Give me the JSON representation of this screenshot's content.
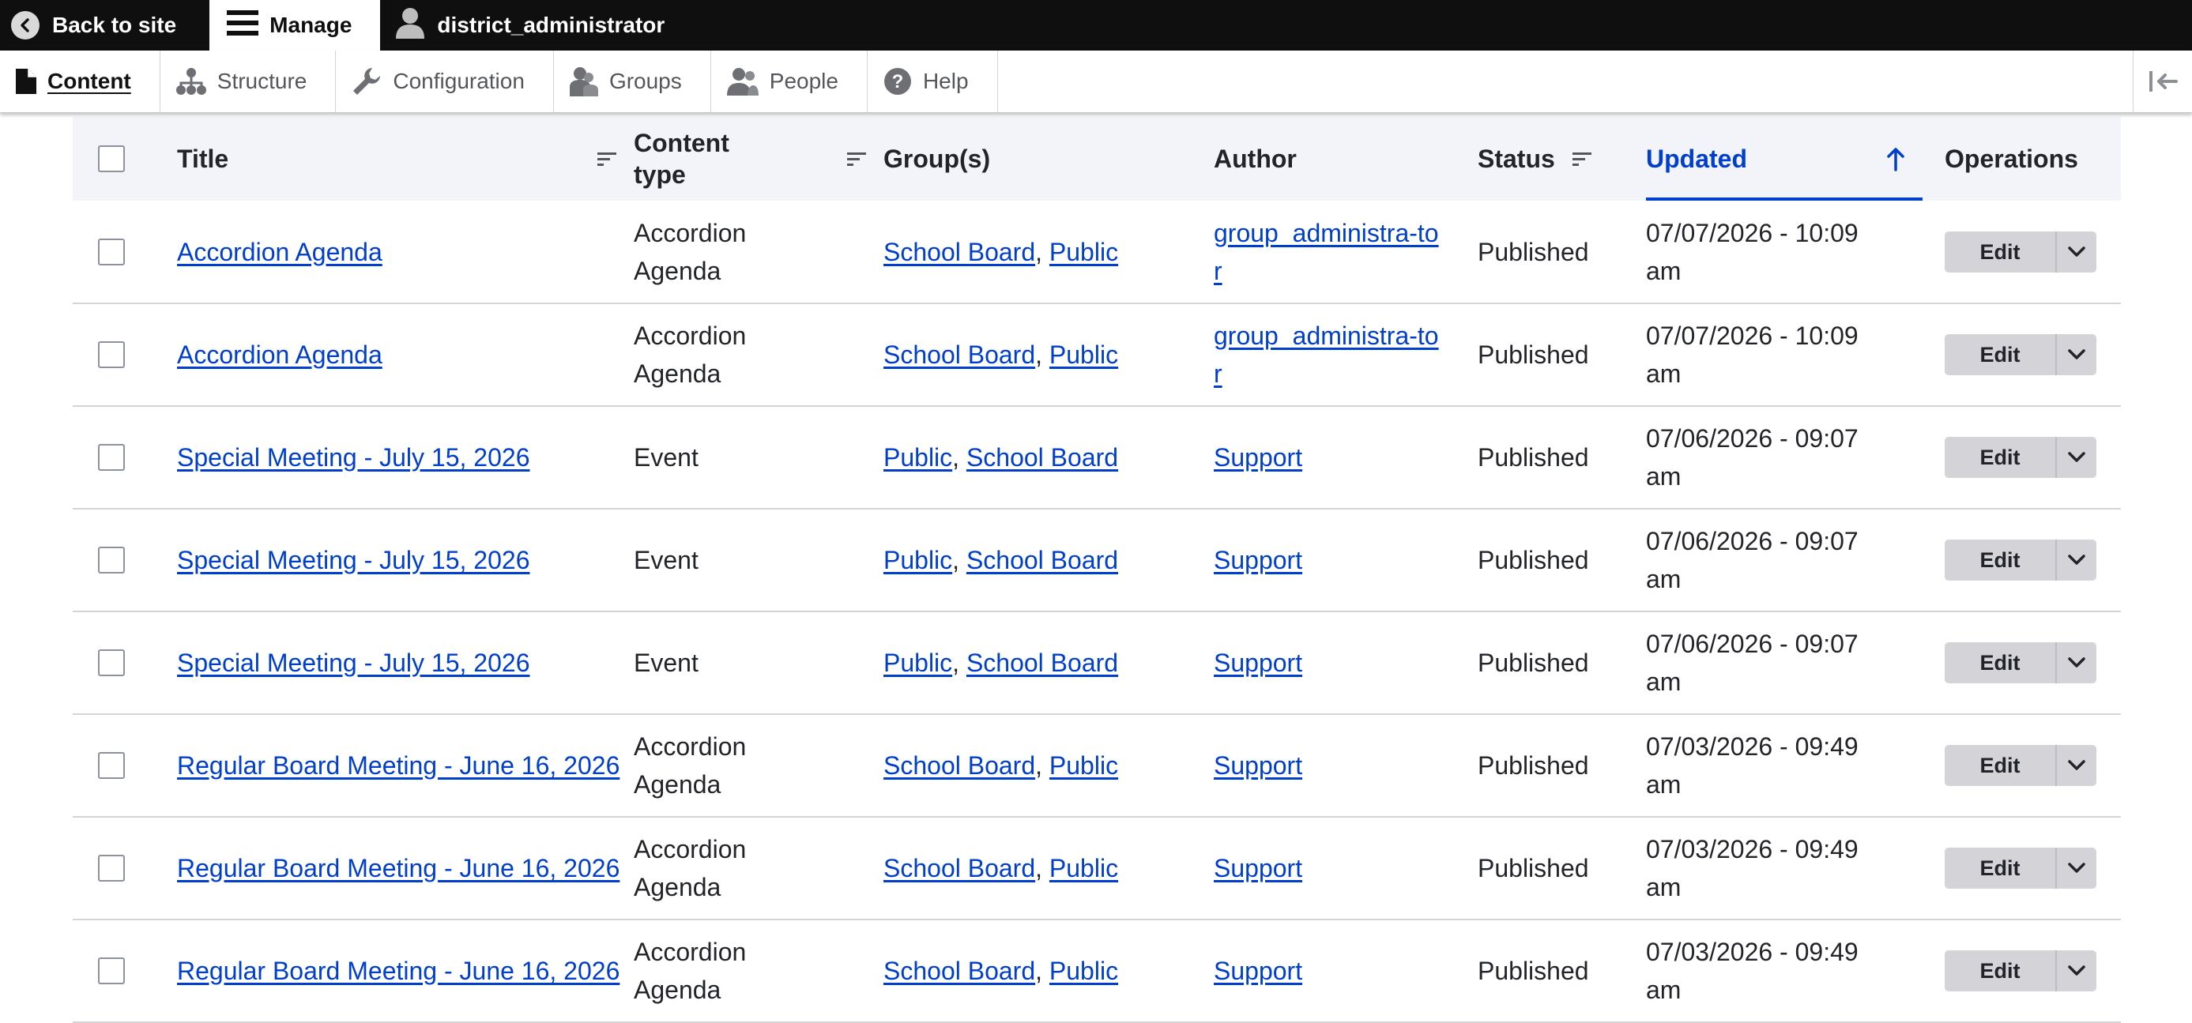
{
  "toolbar": {
    "back_label": "Back to site",
    "manage_label": "Manage",
    "user_label": "district_administrator"
  },
  "tray": {
    "items": [
      {
        "label": "Content",
        "icon": "file-icon",
        "active": true
      },
      {
        "label": "Structure",
        "icon": "sitemap-icon"
      },
      {
        "label": "Configuration",
        "icon": "wrench-icon"
      },
      {
        "label": "Groups",
        "icon": "groups-icon"
      },
      {
        "label": "People",
        "icon": "people-icon"
      },
      {
        "label": "Help",
        "icon": "help-icon"
      }
    ],
    "collapse_icon": "collapse-tray-icon"
  },
  "table": {
    "headers": {
      "title": "Title",
      "content_type": "Content type",
      "groups": "Group(s)",
      "author": "Author",
      "status": "Status",
      "updated": "Updated",
      "operations": "Operations"
    },
    "sort_indicator": "arrow-up-icon",
    "edit_label": "Edit",
    "rows": [
      {
        "title": "Accordion Agenda",
        "type": "Accordion Agenda",
        "group1": "School Board",
        "group2": "Public",
        "author": "group_administra-tor",
        "status": "Published",
        "updated": "07/07/2026 - 10:09 am"
      },
      {
        "title": "Accordion Agenda",
        "type": "Accordion Agenda",
        "group1": "School Board",
        "group2": "Public",
        "author": "group_administra-tor",
        "status": "Published",
        "updated": "07/07/2026 - 10:09 am"
      },
      {
        "title": "Special Meeting - July 15, 2026",
        "type": "Event",
        "group1": "Public",
        "group2": "School Board",
        "author": "Support",
        "status": "Published",
        "updated": "07/06/2026 - 09:07 am"
      },
      {
        "title": "Special Meeting - July 15, 2026",
        "type": "Event",
        "group1": "Public",
        "group2": "School Board",
        "author": "Support",
        "status": "Published",
        "updated": "07/06/2026 - 09:07 am"
      },
      {
        "title": "Special Meeting - July 15, 2026",
        "type": "Event",
        "group1": "Public",
        "group2": "School Board",
        "author": "Support",
        "status": "Published",
        "updated": "07/06/2026 - 09:07 am"
      },
      {
        "title": "Regular Board Meeting - June 16, 2026",
        "type": "Accordion Agenda",
        "group1": "School Board",
        "group2": "Public",
        "author": "Support",
        "status": "Published",
        "updated": "07/03/2026 - 09:49 am"
      },
      {
        "title": "Regular Board Meeting - June 16, 2026",
        "type": "Accordion Agenda",
        "group1": "School Board",
        "group2": "Public",
        "author": "Support",
        "status": "Published",
        "updated": "07/03/2026 - 09:49 am"
      },
      {
        "title": "Regular Board Meeting - June 16, 2026",
        "type": "Accordion Agenda",
        "group1": "School Board",
        "group2": "Public",
        "author": "Support",
        "status": "Published",
        "updated": "07/03/2026 - 09:49 am"
      }
    ]
  },
  "colors": {
    "link": "#003ecc",
    "toolbar_bg": "#0f0f0f",
    "header_bg": "#f3f4f9",
    "button_bg": "#d4d4d8"
  }
}
